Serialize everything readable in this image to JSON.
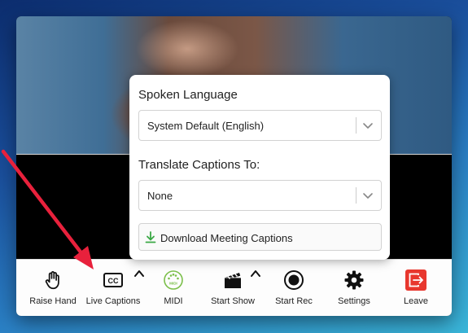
{
  "popup": {
    "spoken_label": "Spoken Language",
    "spoken_value": "System Default (English)",
    "translate_label": "Translate Captions To:",
    "translate_value": "None",
    "download_label": "Download Meeting Captions"
  },
  "toolbar": {
    "raise_hand": "Raise Hand",
    "live_captions": "Live Captions",
    "midi": "MIDI",
    "midi_badge": "MIDI",
    "start_show": "Start Show",
    "start_rec": "Start Rec",
    "settings": "Settings",
    "leave": "Leave"
  },
  "colors": {
    "annotation_arrow": "#e8213c",
    "leave": "#e8372e",
    "midi": "#7bbf4a",
    "download_icon": "#3aa845"
  }
}
